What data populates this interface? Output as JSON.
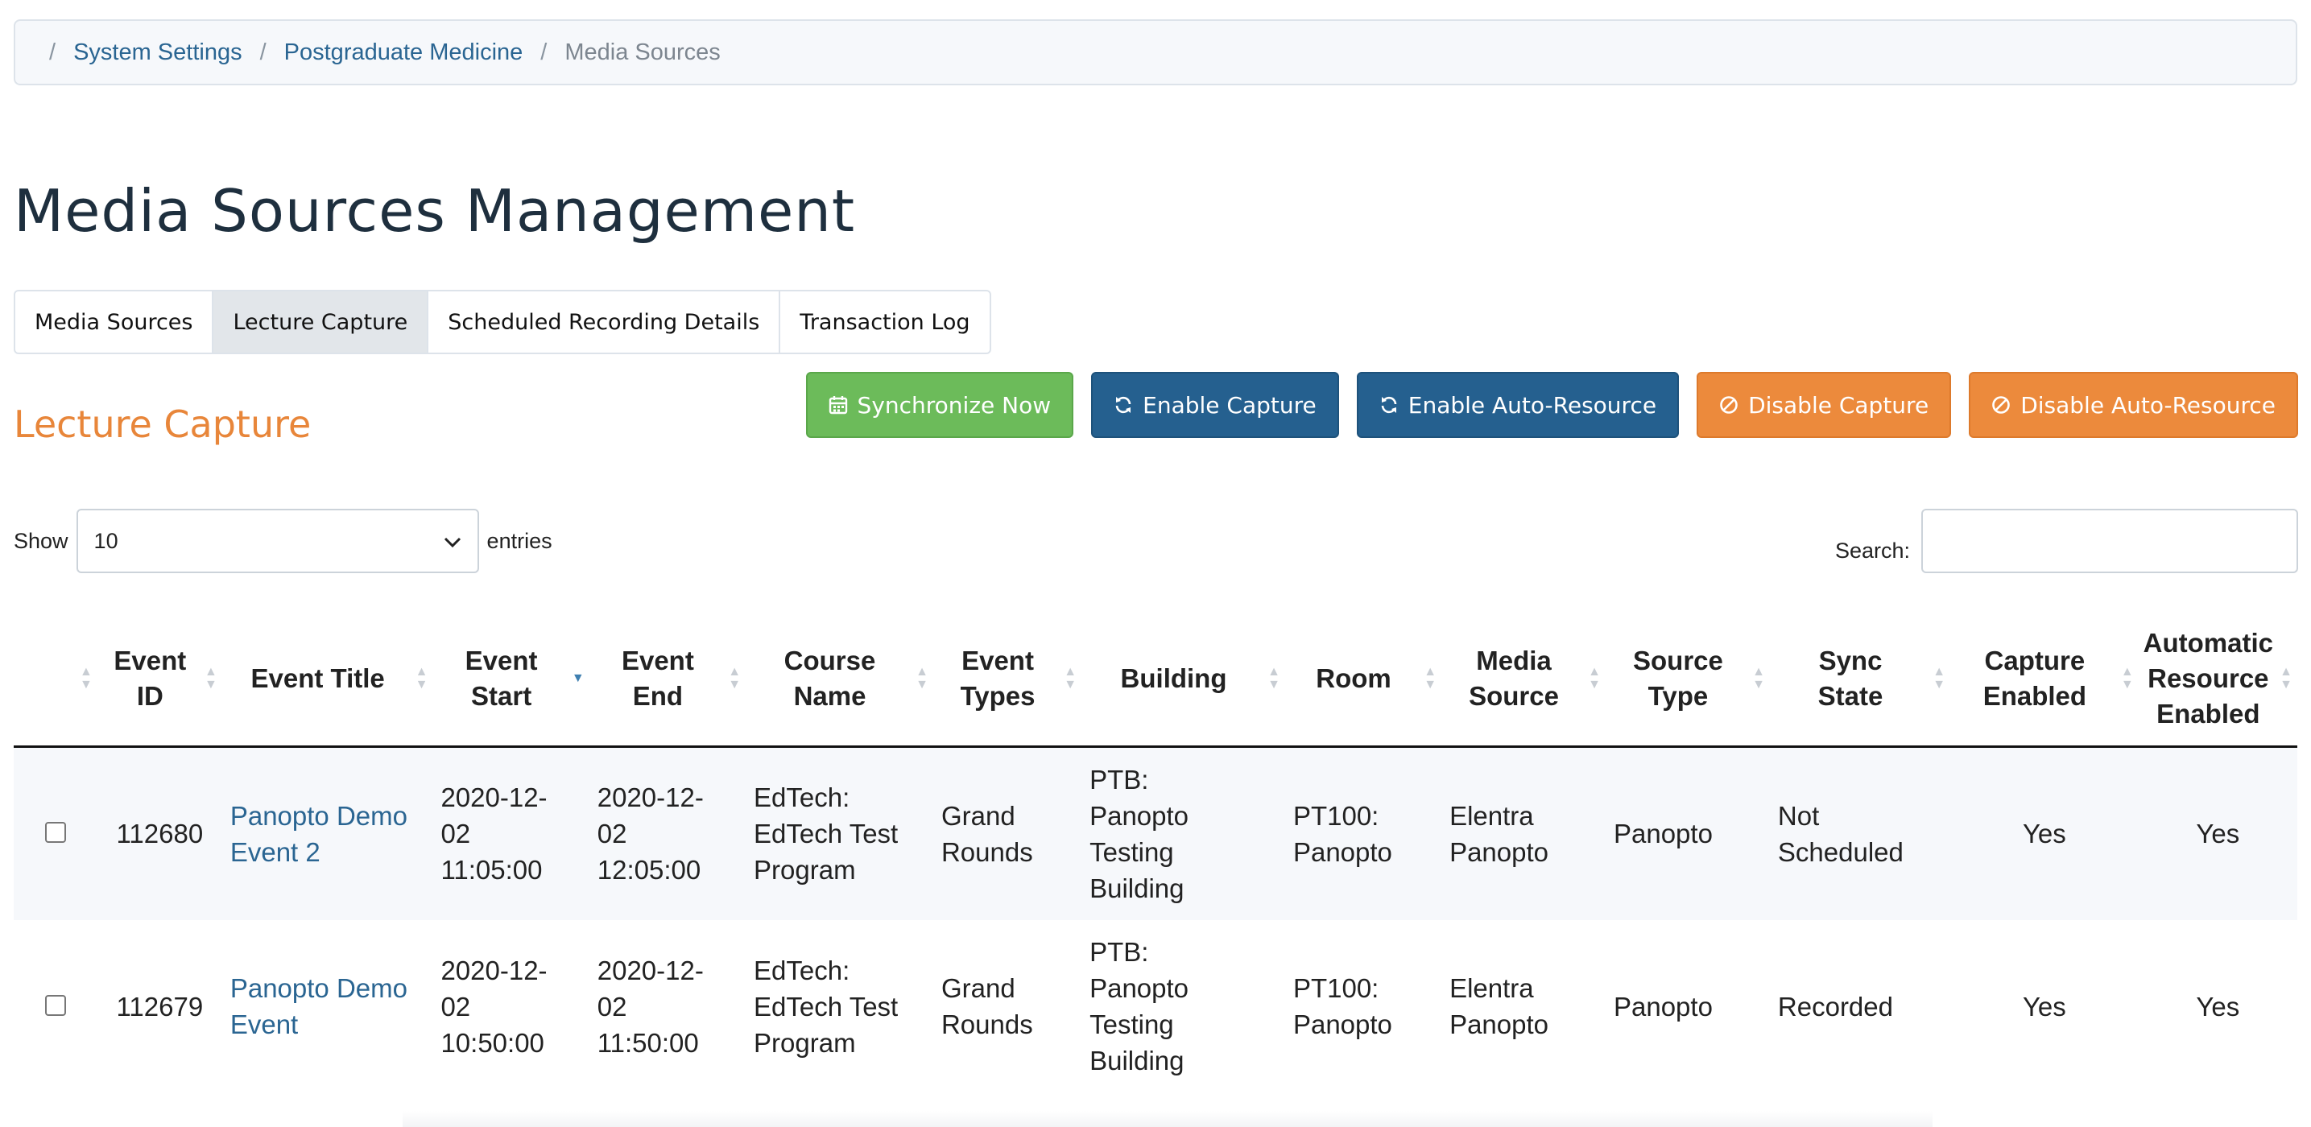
{
  "breadcrumb": {
    "items": [
      {
        "label": "System Settings"
      },
      {
        "label": "Postgraduate Medicine"
      },
      {
        "label": "Media Sources"
      }
    ]
  },
  "page_title": "Media Sources Management",
  "tabs": [
    {
      "label": "Media Sources",
      "active": false
    },
    {
      "label": "Lecture Capture",
      "active": true
    },
    {
      "label": "Scheduled Recording Details",
      "active": false
    },
    {
      "label": "Transaction Log",
      "active": false
    }
  ],
  "section_title": "Lecture Capture",
  "actions": {
    "sync": {
      "label": "Synchronize Now",
      "icon": "calendar-icon",
      "color": "#6cbb5a"
    },
    "enable_capture": {
      "label": "Enable Capture",
      "icon": "refresh-icon",
      "color": "#25608f"
    },
    "enable_auto": {
      "label": "Enable Auto-Resource",
      "icon": "refresh-icon",
      "color": "#25608f"
    },
    "disable_capture": {
      "label": "Disable Capture",
      "icon": "ban-icon",
      "color": "#ec8a3c"
    },
    "disable_auto": {
      "label": "Disable Auto-Resource",
      "icon": "ban-icon",
      "color": "#ec8a3c"
    }
  },
  "length": {
    "show_label": "Show",
    "selected": "10",
    "entries_label": "entries"
  },
  "search": {
    "label": "Search:",
    "value": ""
  },
  "table": {
    "columns": [
      {
        "line1": "Event",
        "line2": "ID",
        "line3": ""
      },
      {
        "line1": "Event Title",
        "line2": "",
        "line3": ""
      },
      {
        "line1": "Event",
        "line2": "Start",
        "line3": ""
      },
      {
        "line1": "Event",
        "line2": "End",
        "line3": ""
      },
      {
        "line1": "Course",
        "line2": "Name",
        "line3": ""
      },
      {
        "line1": "Event",
        "line2": "Types",
        "line3": ""
      },
      {
        "line1": "Building",
        "line2": "",
        "line3": ""
      },
      {
        "line1": "Room",
        "line2": "",
        "line3": ""
      },
      {
        "line1": "Media",
        "line2": "Source",
        "line3": ""
      },
      {
        "line1": "Source",
        "line2": "Type",
        "line3": ""
      },
      {
        "line1": "Sync",
        "line2": "State",
        "line3": ""
      },
      {
        "line1": "Capture",
        "line2": "Enabled",
        "line3": ""
      },
      {
        "line1": "Automatic",
        "line2": "Resource",
        "line3": "Enabled"
      }
    ],
    "rows": [
      {
        "event_id": "112680",
        "title": [
          "Panopto Demo",
          "Event 2"
        ],
        "start": [
          "2020-12-",
          "02",
          "11:05:00"
        ],
        "end": [
          "2020-12-",
          "02",
          "12:05:00"
        ],
        "course": [
          "EdTech:",
          "EdTech Test",
          "Program"
        ],
        "types": [
          "Grand",
          "Rounds"
        ],
        "building": [
          "PTB:",
          "Panopto",
          "Testing",
          "Building"
        ],
        "room": [
          "PT100:",
          "Panopto"
        ],
        "media_source": [
          "Elentra",
          "Panopto"
        ],
        "source_type": "Panopto",
        "sync_state": [
          "Not",
          "Scheduled"
        ],
        "capture_enabled": "Yes",
        "auto_enabled": "Yes"
      },
      {
        "event_id": "112679",
        "title": [
          "Panopto Demo",
          "Event"
        ],
        "start": [
          "2020-12-",
          "02",
          "10:50:00"
        ],
        "end": [
          "2020-12-",
          "02",
          "11:50:00"
        ],
        "course": [
          "EdTech:",
          "EdTech Test",
          "Program"
        ],
        "types": [
          "Grand",
          "Rounds"
        ],
        "building": [
          "PTB:",
          "Panopto",
          "Testing",
          "Building"
        ],
        "room": [
          "PT100:",
          "Panopto"
        ],
        "media_source": [
          "Elentra",
          "Panopto"
        ],
        "source_type": "Panopto",
        "sync_state": [
          "Recorded",
          ""
        ],
        "capture_enabled": "Yes",
        "auto_enabled": "Yes"
      }
    ]
  }
}
